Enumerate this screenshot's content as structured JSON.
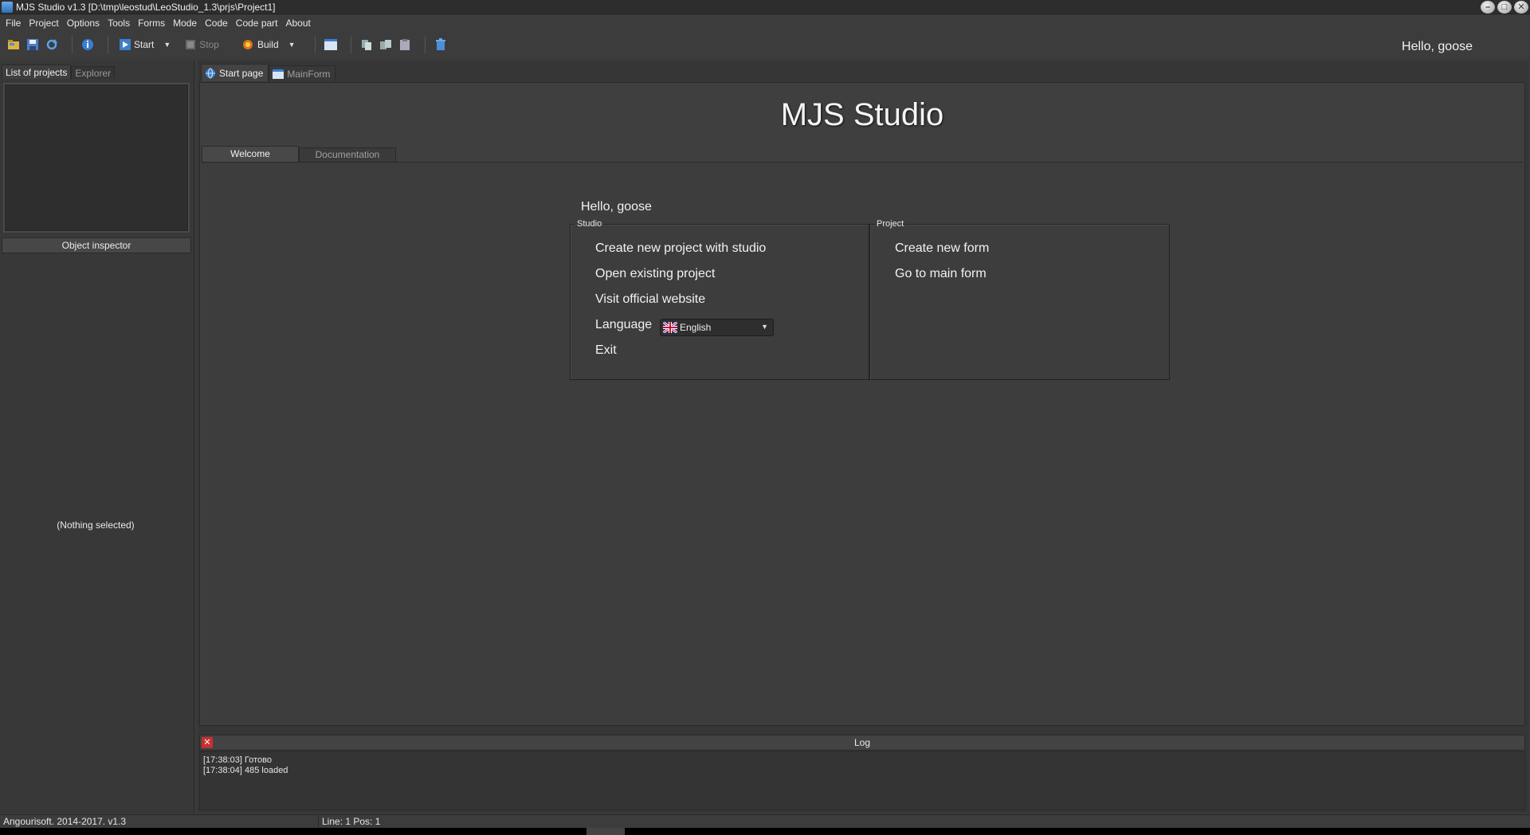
{
  "window": {
    "title": "MJS Studio v1.3 [D:\\tmp\\leostud\\LeoStudio_1.3\\prjs\\Project1]",
    "controls": [
      "minimize-icon",
      "maximize-icon",
      "close-icon"
    ]
  },
  "menu": [
    "File",
    "Project",
    "Options",
    "Tools",
    "Forms",
    "Mode",
    "Code",
    "Code part",
    "About"
  ],
  "toolbar": {
    "start_label": "Start",
    "stop_label": "Stop",
    "build_label": "Build",
    "greeting": "Hello, goose"
  },
  "left_panel": {
    "tabs": [
      "List of projects",
      "Explorer"
    ],
    "object_inspector_title": "Object inspector",
    "object_inspector_empty": "(Nothing selected)"
  },
  "doc_tabs": [
    "Start page",
    "MainForm"
  ],
  "start_page": {
    "title": "MJS Studio",
    "tabs": [
      "Welcome",
      "Documentation"
    ],
    "greeting": "Hello, goose",
    "studio_group": {
      "label": "Studio",
      "links": [
        "Create new project with studio",
        "Open existing project",
        "Visit official website"
      ],
      "language_label": "Language",
      "language_value": "English",
      "exit_label": "Exit"
    },
    "project_group": {
      "label": "Project",
      "links": [
        "Create new form",
        "Go to main form"
      ]
    }
  },
  "log": {
    "title": "Log",
    "lines": [
      "[17:38:03] Готово",
      "[17:38:04] 485 loaded"
    ]
  },
  "status": {
    "left": "Angourisoft. 2014-2017. v1.3",
    "right": "Line: 1 Pos: 1"
  }
}
